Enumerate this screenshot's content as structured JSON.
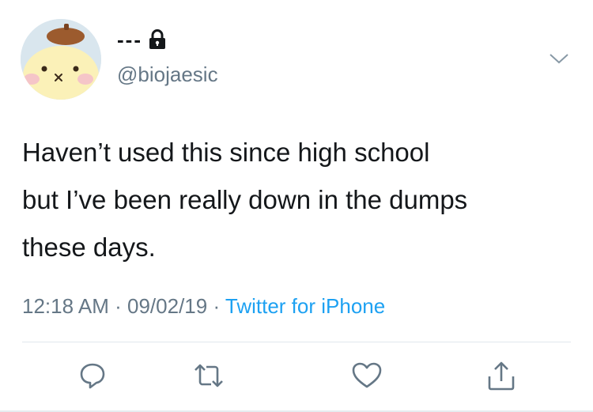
{
  "user": {
    "display_name": "---",
    "handle": "@biojaesic",
    "protected_icon": "lock-icon"
  },
  "tweet": {
    "text": "Haven’t used this since high school\nbut I’ve been really down in the dumps\nthese days.",
    "time": "12:18 AM",
    "date": "09/02/19",
    "separator": "·",
    "source": "Twitter for iPhone"
  },
  "actions": [
    {
      "name": "reply",
      "icon": "reply-icon"
    },
    {
      "name": "retweet",
      "icon": "retweet-icon"
    },
    {
      "name": "like",
      "icon": "heart-icon"
    },
    {
      "name": "share",
      "icon": "share-icon"
    }
  ],
  "colors": {
    "text": "#14171a",
    "secondary": "#657786",
    "link": "#1da1f2",
    "divider": "#e1e8ed"
  }
}
